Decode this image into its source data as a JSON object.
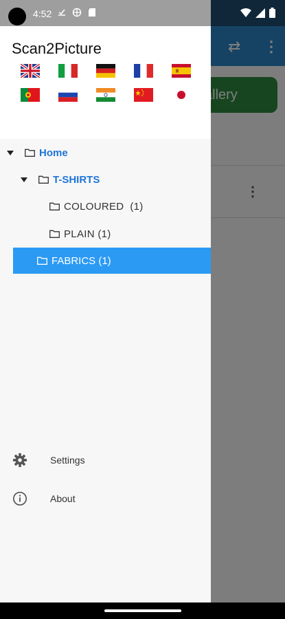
{
  "status_bar": {
    "time": "4:52"
  },
  "background_app": {
    "gallery_button_label": "allery"
  },
  "drawer": {
    "app_title": "Scan2Picture",
    "flags": [
      {
        "name": "flag-uk-icon"
      },
      {
        "name": "flag-italy-icon"
      },
      {
        "name": "flag-germany-icon"
      },
      {
        "name": "flag-france-icon"
      },
      {
        "name": "flag-spain-icon"
      },
      {
        "name": "flag-portugal-icon"
      },
      {
        "name": "flag-russia-icon"
      },
      {
        "name": "flag-india-icon"
      },
      {
        "name": "flag-china-icon"
      },
      {
        "name": "flag-japan-icon"
      }
    ],
    "tree": {
      "home": "Home",
      "tshirts": "T-SHIRTS",
      "coloured": "COLOURED  (1)",
      "plain": "PLAIN (1)",
      "fabrics": "FABRICS (1)"
    },
    "menu": {
      "settings": "Settings",
      "about": "About"
    }
  },
  "colors": {
    "selected_row": "#2b9af3",
    "link_blue": "#1e75d9",
    "toolbar": "#2d86c8",
    "gallery_button": "#2f8a3e"
  }
}
